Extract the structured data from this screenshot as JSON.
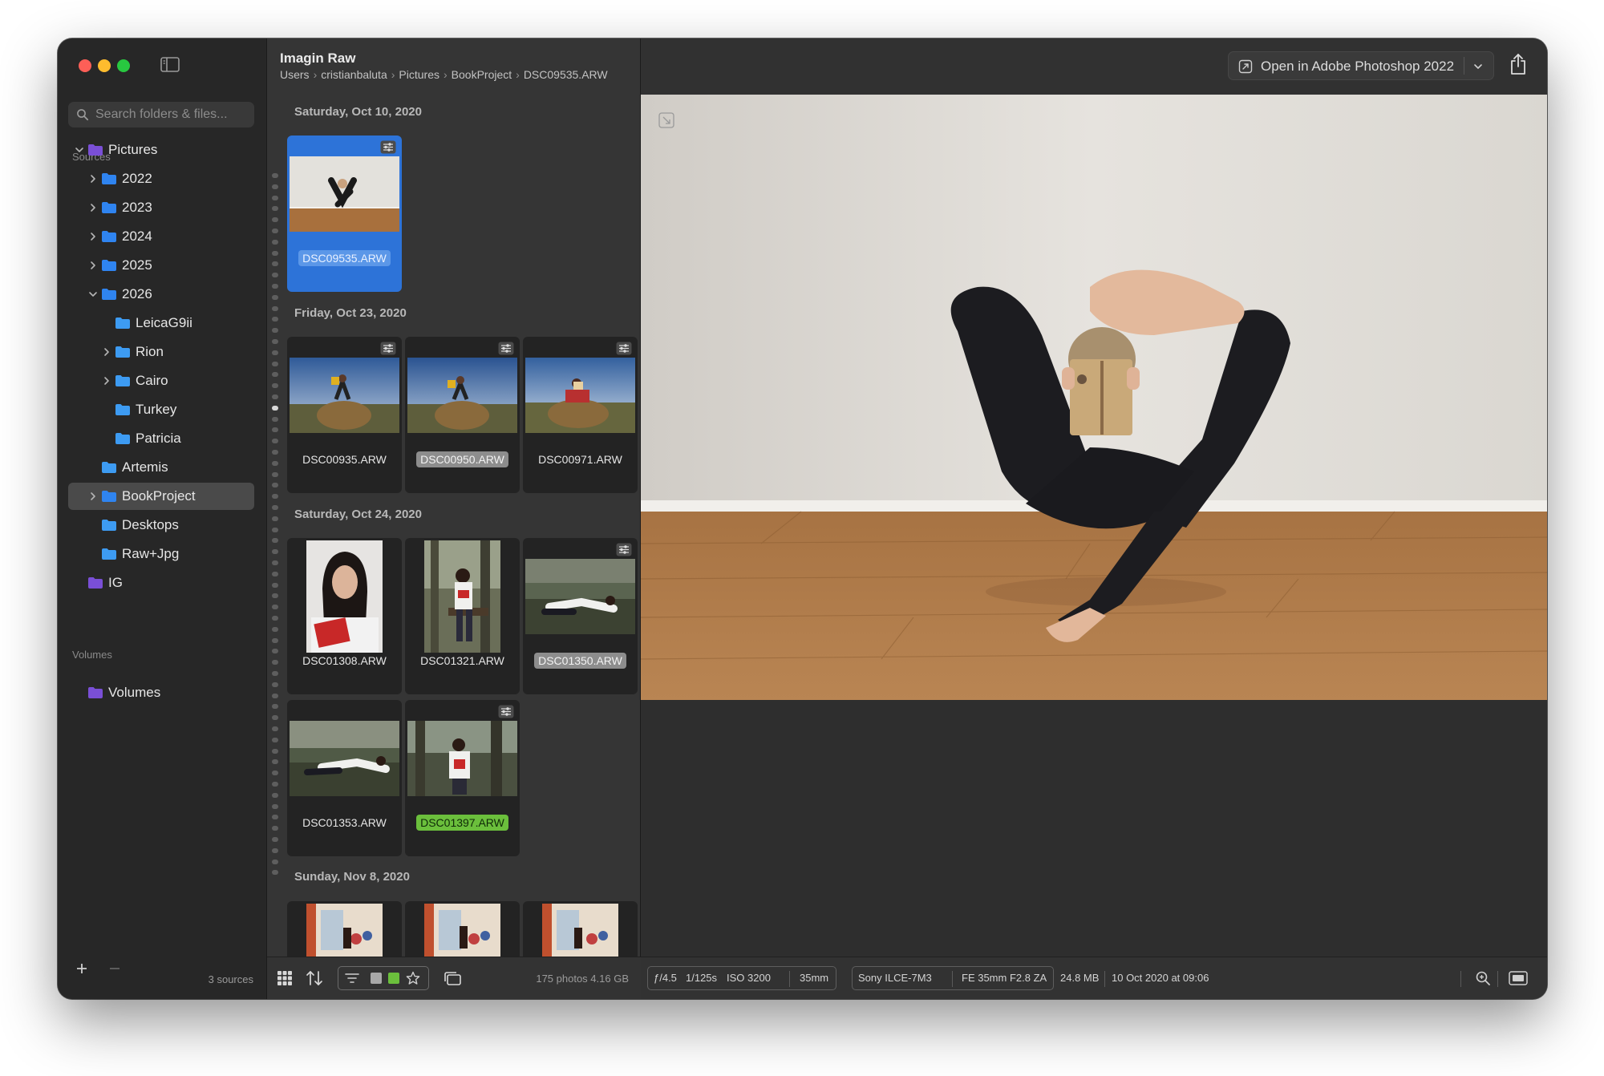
{
  "window": {
    "traffic_lights": [
      "close",
      "minimize",
      "maximize"
    ]
  },
  "sidebar": {
    "search_placeholder": "Search folders & files...",
    "sources_label": "Sources",
    "volumes_label": "Volumes",
    "tree": [
      {
        "label": "Pictures",
        "color": "#7a4fd6",
        "expanded": true
      },
      {
        "label": "2022",
        "color": "#2f84f0"
      },
      {
        "label": "2023",
        "color": "#2f84f0"
      },
      {
        "label": "2024",
        "color": "#2f84f0"
      },
      {
        "label": "2025",
        "color": "#2f84f0"
      },
      {
        "label": "2026",
        "color": "#2f84f0",
        "expanded": true
      },
      {
        "label": "LeicaG9ii",
        "color": "#3d9bf2"
      },
      {
        "label": "Rion",
        "color": "#3d9bf2"
      },
      {
        "label": "Cairo",
        "color": "#3d9bf2"
      },
      {
        "label": "Turkey",
        "color": "#3d9bf2"
      },
      {
        "label": "Patricia",
        "color": "#3d9bf2"
      },
      {
        "label": "Artemis",
        "color": "#3d9bf2"
      },
      {
        "label": "BookProject",
        "color": "#2f84f0",
        "selected": true
      },
      {
        "label": "Desktops",
        "color": "#3d9bf2"
      },
      {
        "label": "Raw+Jpg",
        "color": "#3d9bf2"
      },
      {
        "label": "IG",
        "color": "#7a4fd6"
      }
    ],
    "volumes": [
      {
        "label": "Volumes",
        "color": "#7a4fd6"
      }
    ],
    "footer_count": "3 sources"
  },
  "browser": {
    "title": "Imagin Raw",
    "breadcrumb": [
      "Users",
      "cristianbaluta",
      "Pictures",
      "BookProject",
      "DSC09535.ARW"
    ],
    "groups": [
      {
        "date": "Saturday, Oct 10, 2020"
      },
      {
        "date": "Friday, Oct 23, 2020"
      },
      {
        "date": "Saturday, Oct 24, 2020"
      },
      {
        "date": "Sunday, Nov 8, 2020"
      }
    ],
    "files": [
      {
        "name": "DSC09535.ARW",
        "label": "blue",
        "selected": true,
        "adjusted": true
      },
      {
        "name": "DSC00935.ARW",
        "label": "none",
        "adjusted": true
      },
      {
        "name": "DSC00950.ARW",
        "label": "gray",
        "adjusted": true
      },
      {
        "name": "DSC00971.ARW",
        "label": "none",
        "adjusted": true
      },
      {
        "name": "DSC01308.ARW",
        "label": "none",
        "adjusted": false
      },
      {
        "name": "DSC01321.ARW",
        "label": "none",
        "adjusted": false
      },
      {
        "name": "DSC01350.ARW",
        "label": "gray",
        "adjusted": true
      },
      {
        "name": "DSC01353.ARW",
        "label": "none",
        "adjusted": false
      },
      {
        "name": "DSC01397.ARW",
        "label": "green",
        "adjusted": true
      }
    ],
    "footer_count": "175 photos 4.16 GB"
  },
  "viewer": {
    "open_in_label": "Open in Adobe Photoshop 2022",
    "metadata": {
      "aperture": "ƒ/4.5",
      "shutter": "1/125s",
      "iso": "ISO 3200",
      "focal": "35mm",
      "camera": "Sony ILCE-7M3",
      "lens": "FE 35mm F2.8 ZA",
      "size": "24.8 MB",
      "date": "10 Oct 2020 at 09:06"
    }
  },
  "colors": {
    "accent": "#2d73d8",
    "label_green": "#6bbf3c",
    "label_gray": "#8d8d8d"
  }
}
